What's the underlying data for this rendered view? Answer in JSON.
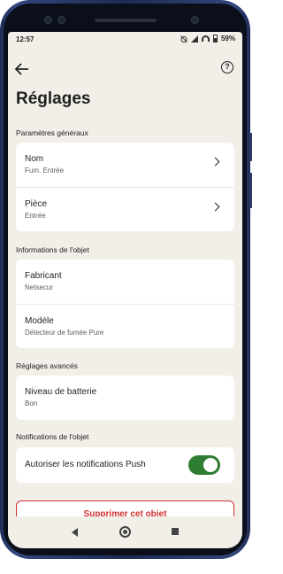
{
  "status_bar": {
    "time": "12:57",
    "battery": "59%",
    "icons": [
      "alarm-off-icon",
      "signal-icon",
      "wifi-icon",
      "battery-icon"
    ]
  },
  "top_bar": {
    "back_icon": "arrow-left-icon",
    "help_icon": "help-circle-icon",
    "help_glyph": "?"
  },
  "page_title": "Réglages",
  "sections": {
    "general": {
      "title": "Paramètres généraux",
      "rows": [
        {
          "label": "Nom",
          "value": "Fum. Entrée"
        },
        {
          "label": "Pièce",
          "value": "Entrée"
        }
      ]
    },
    "object_info": {
      "title": "Informations de l'objet",
      "rows": [
        {
          "label": "Fabricant",
          "value": "Netsecur"
        },
        {
          "label": "Modèle",
          "value": "Détecteur de fumée Pure"
        }
      ]
    },
    "advanced": {
      "title": "Réglages avancés",
      "rows": [
        {
          "label": "Niveau de batterie",
          "value": "Bon"
        }
      ]
    },
    "notifications": {
      "title": "Notifications de l'objet",
      "push_label": "Autoriser les notifications Push",
      "push_enabled": true
    }
  },
  "delete_button": "Supprimer cet objet",
  "colors": {
    "background": "#f1efe8",
    "card": "#ffffff",
    "toggle_on": "#2e7d32",
    "danger": "#d32f2f"
  }
}
